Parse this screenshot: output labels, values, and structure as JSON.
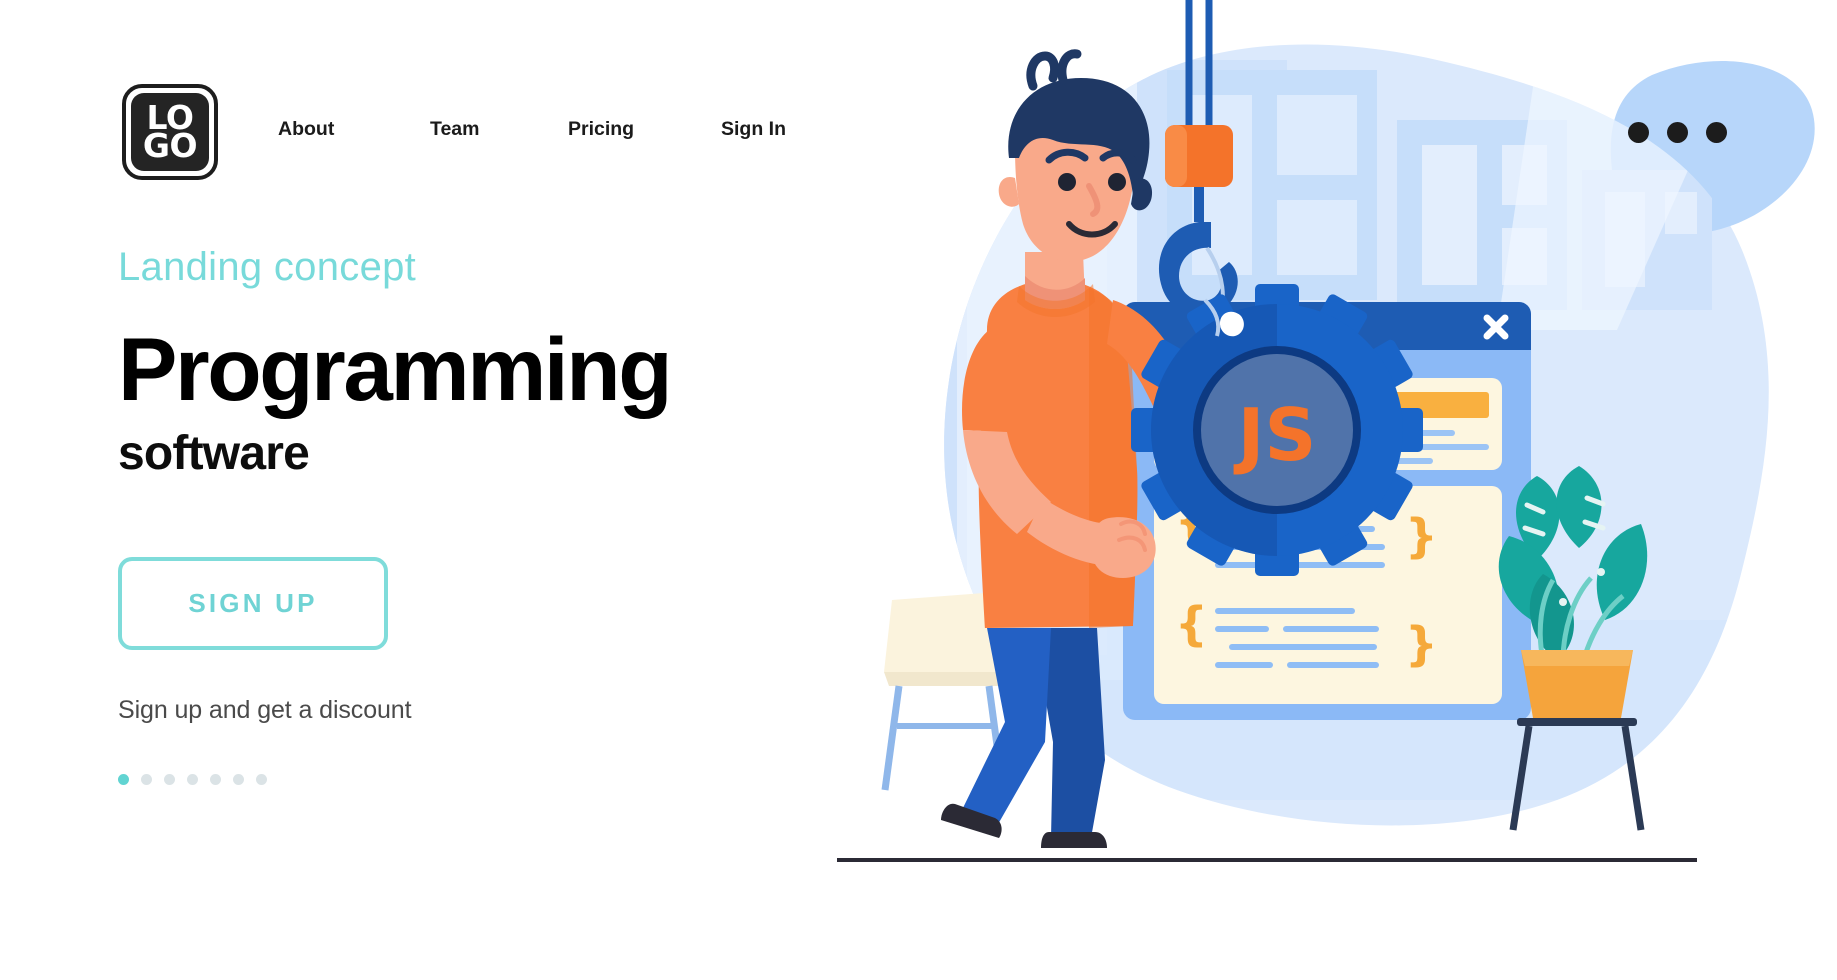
{
  "header": {
    "logo": {
      "line1": "LO",
      "line2": "GO",
      "name": "LOGO"
    },
    "nav": [
      {
        "label": "About"
      },
      {
        "label": "Team"
      },
      {
        "label": "Pricing"
      },
      {
        "label": "Sign In"
      }
    ],
    "menu_icon": "kebab-menu-icon"
  },
  "hero": {
    "eyebrow": "Landing concept",
    "title": "Programming",
    "subtitle": "software",
    "cta_label": "SIGN UP",
    "discount_text": "Sign up and get a discount",
    "carousel": {
      "total_dots": 7,
      "active_index": 0
    }
  },
  "illustration": {
    "alt": "Man holding a large blue gear with JS logo, crane hook above, browser window with code behind",
    "gear_label": "JS",
    "window_close_label": "✕",
    "code_braces": [
      "{",
      "}",
      "{",
      "}"
    ]
  },
  "colors": {
    "accent_teal": "#6fd3d4",
    "eyebrow_teal": "#78dada",
    "title_black": "#000000",
    "body_gray": "#4a4a4a",
    "brand_blue": "#1964c8",
    "deep_blue": "#134a9e",
    "orange": "#f4732a",
    "shirt_orange": "#f87c3c",
    "skin": "#f9a98a",
    "hair_navy": "#1f3864",
    "bg_blue_light": "#dce9fb",
    "bg_blue_mid": "#b9d4f7",
    "cream": "#fdf6e0",
    "code_line_blue": "#8fbdf5",
    "plant_teal": "#12a5a0",
    "pot_orange": "#f5a43c",
    "dot_inactive": "#dbe3e6"
  }
}
